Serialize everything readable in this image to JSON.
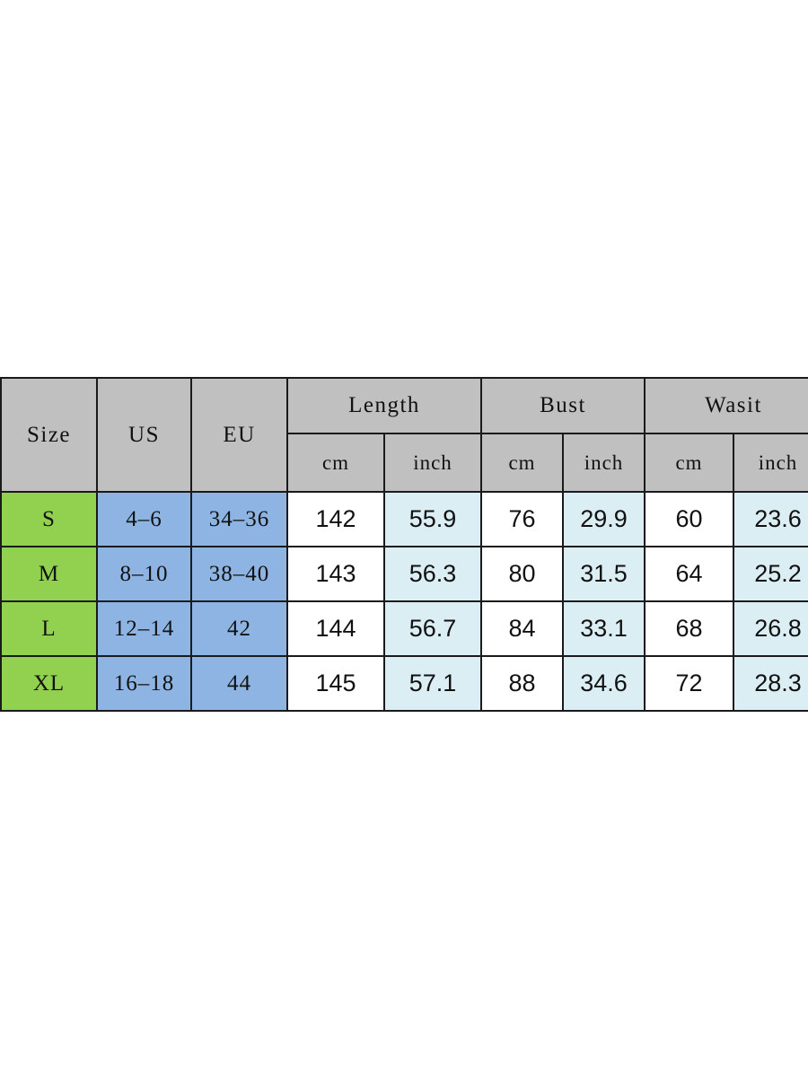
{
  "table": {
    "header": {
      "size_label": "Size",
      "us_label": "US",
      "eu_label": "EU",
      "groups": [
        {
          "label": "Length",
          "units": [
            "cm",
            "inch"
          ]
        },
        {
          "label": "Bust",
          "units": [
            "cm",
            "inch"
          ]
        },
        {
          "label": "Wasit",
          "units": [
            "cm",
            "inch"
          ]
        }
      ]
    },
    "rows": [
      {
        "size": "S",
        "us": "4–6",
        "eu": "34–36",
        "length_cm": "142",
        "length_inch": "55.9",
        "bust_cm": "76",
        "bust_inch": "29.9",
        "waist_cm": "60",
        "waist_inch": "23.6"
      },
      {
        "size": "M",
        "us": "8–10",
        "eu": "38–40",
        "length_cm": "143",
        "length_inch": "56.3",
        "bust_cm": "80",
        "bust_inch": "31.5",
        "waist_cm": "64",
        "waist_inch": "25.2"
      },
      {
        "size": "L",
        "us": "12–14",
        "eu": "42",
        "length_cm": "144",
        "length_inch": "56.7",
        "bust_cm": "84",
        "bust_inch": "33.1",
        "waist_cm": "68",
        "waist_inch": "26.8"
      },
      {
        "size": "XL",
        "us": "16–18",
        "eu": "44",
        "length_cm": "145",
        "length_inch": "57.1",
        "bust_cm": "88",
        "bust_inch": "34.6",
        "waist_cm": "72",
        "waist_inch": "28.3"
      }
    ]
  },
  "colors": {
    "header_gray": "#c0c0c0",
    "size_green": "#92d050",
    "region_blue": "#8db4e2",
    "inch_light_blue": "#daeef3",
    "cm_white": "#ffffff",
    "border": "#1a1a1a",
    "page_background": "#ffffff"
  }
}
